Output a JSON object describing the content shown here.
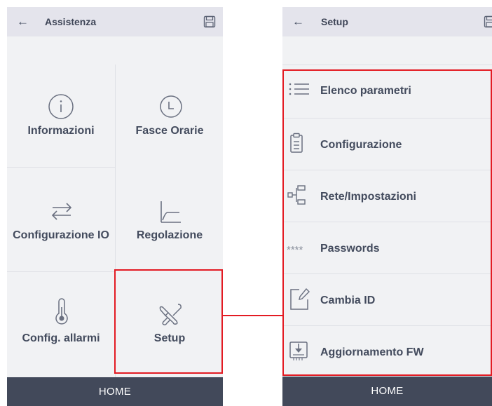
{
  "left_screen": {
    "title": "Assistenza",
    "back_glyph": "←",
    "footer": "HOME",
    "tiles": [
      {
        "label": "Informazioni",
        "icon": "info-icon"
      },
      {
        "label": "Fasce Orarie",
        "icon": "clock-icon"
      },
      {
        "label": "Configurazione IO",
        "icon": "swap-arrows-icon"
      },
      {
        "label": "Regolazione",
        "icon": "curve-chart-icon"
      },
      {
        "label": "Config. allarmi",
        "icon": "thermometer-icon"
      },
      {
        "label": "Setup",
        "icon": "tools-icon"
      }
    ]
  },
  "right_screen": {
    "title": "Setup",
    "back_glyph": "←",
    "footer": "HOME",
    "items": [
      {
        "label": "Elenco parametri",
        "icon": "list-icon"
      },
      {
        "label": "Configurazione",
        "icon": "clipboard-icon"
      },
      {
        "label": "Rete/Impostazioni",
        "icon": "network-icon"
      },
      {
        "label": "Passwords",
        "icon": "asterisks-icon",
        "glyph": "****"
      },
      {
        "label": "Cambia ID",
        "icon": "edit-icon"
      },
      {
        "label": "Aggiornamento FW",
        "icon": "firmware-download-icon"
      }
    ]
  },
  "colors": {
    "highlight": "#e31b23",
    "footer": "#42495a",
    "header": "#e4e4ec",
    "panel": "#f1f2f4"
  }
}
